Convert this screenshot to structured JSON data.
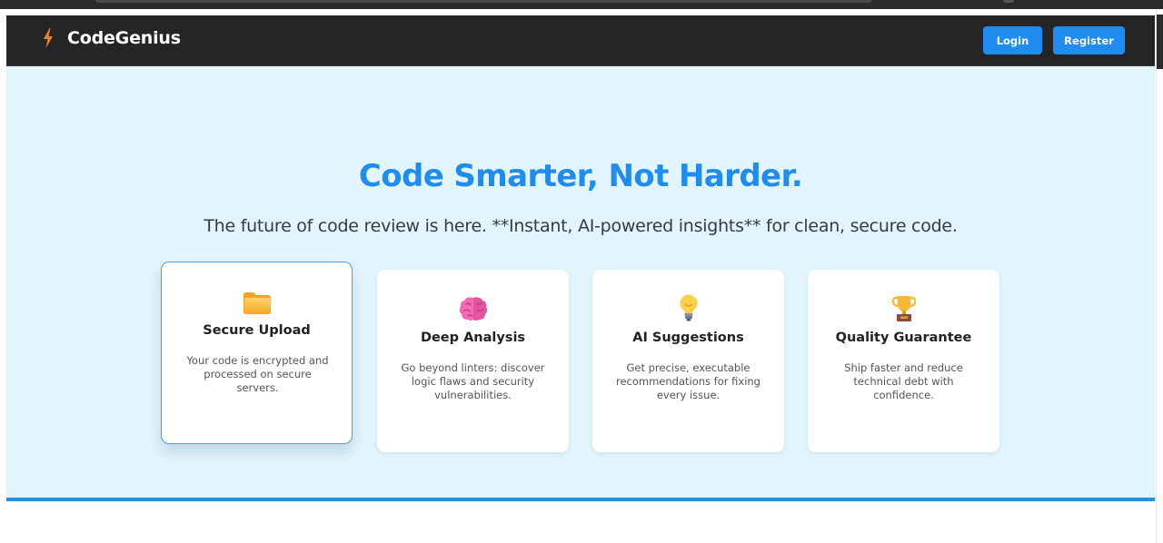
{
  "brand": {
    "name": "CodeGenius",
    "icon": "lightning-bolt-icon",
    "icon_color": "#f08030"
  },
  "nav": {
    "login_label": "Login",
    "register_label": "Register"
  },
  "hero": {
    "title": "Code Smarter, Not Harder.",
    "subtitle": "The future of code review is here. **Instant, AI-powered insights** for clean, secure code."
  },
  "features": [
    {
      "icon": "folder-icon",
      "title": "Secure Upload",
      "description": "Your code is encrypted and processed on secure servers."
    },
    {
      "icon": "brain-icon",
      "title": "Deep Analysis",
      "description": "Go beyond linters: discover logic flaws and security vulnerabilities."
    },
    {
      "icon": "lightbulb-icon",
      "title": "AI Suggestions",
      "description": "Get precise, executable recommendations for fixing every issue."
    },
    {
      "icon": "trophy-icon",
      "title": "Quality Guarantee",
      "description": "Ship faster and reduce technical debt with confidence."
    }
  ],
  "colors": {
    "accent": "#1e8cf0",
    "navbar_bg": "#252525",
    "page_bg": "#e3f5fc"
  }
}
